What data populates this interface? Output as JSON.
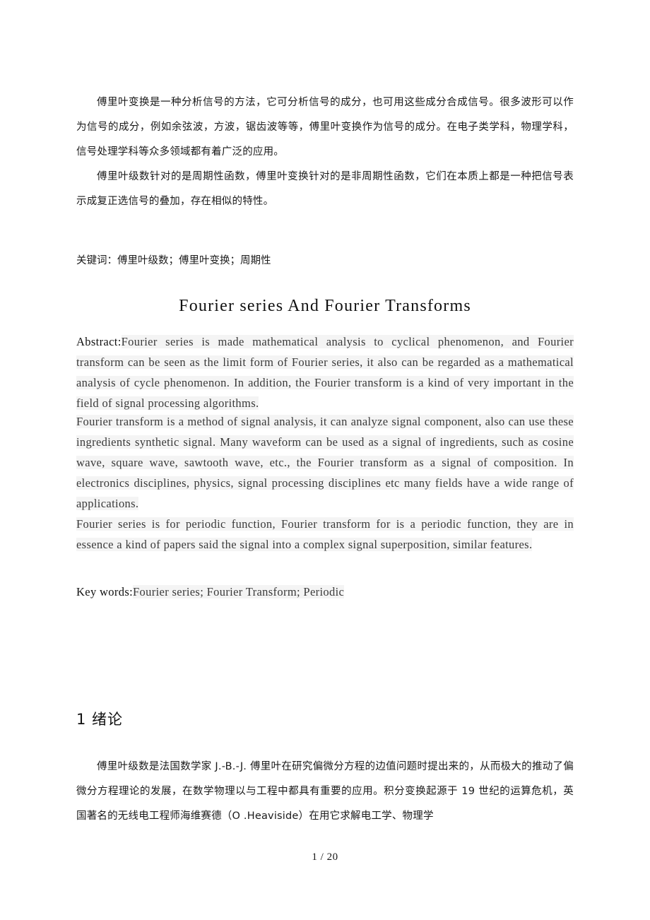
{
  "document": {
    "language_primary": "zh-CN",
    "page_footer": "1 / 20"
  },
  "chinese_abstract": {
    "paragraphs": [
      "傅里叶变换是一种分析信号的方法，它可分析信号的成分，也可用这些成分合成信号。很多波形可以作为信号的成分，例如余弦波，方波，锯齿波等等，傅里叶变换作为信号的成分。在电子类学科，物理学科，信号处理学科等众多领域都有着广泛的应用。",
      "傅里叶级数针对的是周期性函数，傅里叶变换针对的是非周期性函数，它们在本质上都是一种把信号表示成复正选信号的叠加，存在相似的特性。"
    ],
    "keywords_line": "关键词：傅里叶级数；傅里叶变换；周期性"
  },
  "english_section": {
    "title": "Fourier series And Fourier Transforms",
    "abstract_label": "Abstract:",
    "abstract_paragraphs": [
      "Fourier series is made mathematical analysis to cyclical phenomenon, and Fourier transform can be seen as the limit form of Fourier series, it also can be regarded as a mathematical analysis of cycle phenomenon. In addition, the Fourier transform is a kind of very important in the field of signal processing algorithms.",
      "Fourier transform is a method of signal analysis, it can analyze signal component, also can use these ingredients synthetic signal. Many waveform can be used as a signal of ingredients, such as cosine wave, square wave, sawtooth wave, etc., the Fourier transform as a signal of composition. In electronics disciplines, physics, signal processing disciplines etc many fields have a wide range of applications.",
      "Fourier series is for periodic function, Fourier transform for is a periodic function, they are in essence a kind of papers said the signal into a complex signal superposition, similar features."
    ],
    "keywords_label": "Key words:",
    "keywords_value": "Fourier series; Fourier Transform; Periodic"
  },
  "chapter_one": {
    "heading": "1 绪论",
    "paragraphs": [
      "傅里叶级数是法国数学家 J.-B.-J. 傅里叶在研究偏微分方程的边值问题时提出来的，从而极大的推动了偏微分方程理论的发展，在数学物理以与工程中都具有重要的应用。积分变换起源于 19 世纪的运算危机，英国著名的无线电工程师海维赛德（O .Heaviside）在用它求解电工学、物理学"
    ]
  },
  "colors": {
    "page_background": "#ffffff",
    "body_text": "#1a1a1a",
    "english_text": "#2b2b2b",
    "highlight_background": "#f4f4f4"
  }
}
